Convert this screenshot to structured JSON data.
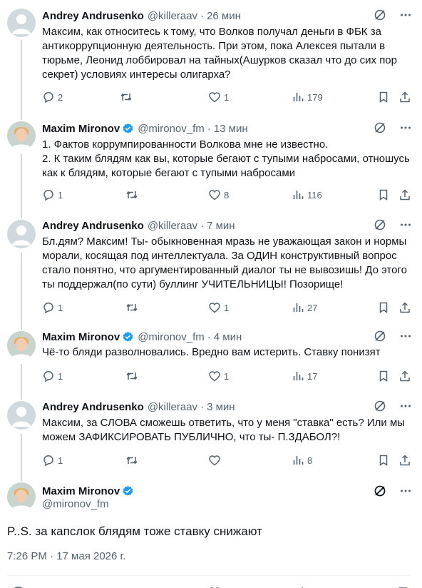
{
  "tweets": [
    {
      "name": "Andrey Andrusenko",
      "handle": "@killeraav",
      "dot": "·",
      "time": "26 мин",
      "verified": false,
      "text": "Максим, как относитесь к тому, что Волков получал деньги в ФБК за\nантикоррупционную деятельность. При этом, пока Алексея пытали в\nтюрьме, Леонид лоббировал на тайных(Ашурков сказал что до сих пор\nсекрет) условиях интересы олигарха?",
      "replies": "2",
      "reposts": "",
      "likes": "1",
      "views": "179"
    },
    {
      "name": "Maxim Mironov",
      "handle": "@mironov_fm",
      "dot": "·",
      "time": "13 мин",
      "verified": true,
      "text": "1. Фактов коррумпированности Волкова мне не известно.\n2. К таким блядям как вы, которые бегают с тупыми набросами, отношусь\nкак к блядям, которые бегают с тупыми набросами",
      "replies": "1",
      "reposts": "",
      "likes": "8",
      "views": "116"
    },
    {
      "name": "Andrey Andrusenko",
      "handle": "@killeraav",
      "dot": "·",
      "time": "7 мин",
      "verified": false,
      "text": "Бл.дям? Максим! Ты- обыкновенная мразь не уважающая закон и нормы\nморали, косящая под интеллектуала. За ОДИН конструктивный вопрос\nстало понятно, что аргументированный диалог ты не вывозишь! До этого\nты поддержал(по сути) буллинг УЧИТЕЛЬНИЦЫ! Позорище!",
      "replies": "1",
      "reposts": "",
      "likes": "1",
      "views": "27"
    },
    {
      "name": "Maxim Mironov",
      "handle": "@mironov_fm",
      "dot": "·",
      "time": "4 мин",
      "verified": true,
      "text": "Чё-то бляди разволновались. Вредно вам истерить. Ставку понизят",
      "replies": "1",
      "reposts": "",
      "likes": "1",
      "views": "17"
    },
    {
      "name": "Andrey Andrusenko",
      "handle": "@killeraav",
      "dot": "·",
      "time": "3 мин",
      "verified": false,
      "text": "Максим, за СЛОВА сможешь ответить, что у меня \"ставка\" есть? Или мы\nможем ЗАФИКСИРОВАТЬ ПУБЛИЧНО, что ты- П.ЗДАБОЛ?!",
      "replies": "1",
      "reposts": "",
      "likes": "",
      "views": "8"
    }
  ],
  "main_tweet": {
    "name": "Maxim Mironov",
    "handle": "@mironov_fm",
    "verified": true,
    "text": "P..S.  за капслок блядям тоже ставку снижают",
    "timestamp": "7:26 PM · 17 мая 2026 г."
  },
  "colors": {
    "text": "#0f1419",
    "secondary": "#536471",
    "verified": "#1d9bf0",
    "line": "#cfd9de",
    "divider": "#eff3f4"
  },
  "icons": [
    "reply-icon",
    "repost-icon",
    "like-icon",
    "views-icon",
    "bookmark-icon",
    "share-icon",
    "grok-icon",
    "more-icon",
    "verified-icon"
  ]
}
